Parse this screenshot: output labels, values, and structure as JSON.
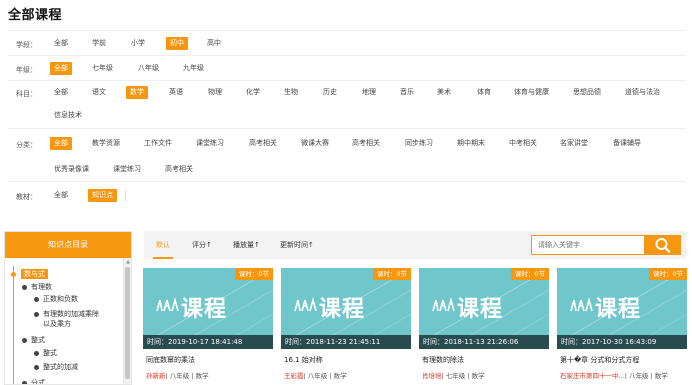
{
  "page_title": "全部课程",
  "filters": {
    "stage": {
      "label": "学段：",
      "options": [
        "全部",
        "学前",
        "小学",
        "初中",
        "高中"
      ],
      "active": "初中"
    },
    "grade": {
      "label": "年级：",
      "options": [
        "全部",
        "七年级",
        "八年级",
        "九年级"
      ],
      "active": "全部"
    },
    "subject": {
      "label": "科目：",
      "options": [
        "全部",
        "语文",
        "数学",
        "英语",
        "物理",
        "化学",
        "生物",
        "历史",
        "地理",
        "音乐",
        "美术",
        "体育",
        "体育与健康",
        "思想品德",
        "道德与法治",
        "信息技术"
      ],
      "active": "数学"
    },
    "category": {
      "label": "分类：",
      "options": [
        "全部",
        "教学资源",
        "工作文件",
        "课堂练习",
        "高考相关",
        "微课大赛",
        "高考相关",
        "同步练习",
        "期中期末",
        "中考相关",
        "名家讲堂",
        "备课辅导",
        "优秀录像课",
        "课堂练习",
        "高考相关"
      ],
      "active": "全部"
    },
    "textbook": {
      "label": "教材：",
      "options": [
        "全部",
        "知识点"
      ],
      "active": "知识点"
    }
  },
  "tree": {
    "title": "知识点目录",
    "nodes": [
      "数与式",
      "有理数",
      "正数和负数",
      "有理数的加减乘除",
      "以及乘方",
      "整式",
      "整式",
      "整式的加减",
      "分式"
    ]
  },
  "sortbar": {
    "options": [
      "默认",
      "评分↑",
      "播放量↑",
      "更新时间↑"
    ],
    "active": "默认",
    "search_placeholder": "请输入关键字"
  },
  "cards": [
    {
      "badge": "课时：0节",
      "logo": "课程",
      "time": "时间：2019-10-17 18:41:48",
      "title": "同底数幂的乘法",
      "teacher": "孙新新",
      "meta": "| 八年级 | 数学"
    },
    {
      "badge": "课时：0节",
      "logo": "课程",
      "time": "时间：2018-11-23 21:45:11",
      "title": "16.1 始对称",
      "teacher": "王彩霞",
      "meta": "| 八年级 | 数学"
    },
    {
      "badge": "课时：0节",
      "logo": "课程",
      "time": "时间：2018-11-13 21:26:06",
      "title": "有理数的除法",
      "teacher": "肖培培",
      "meta": "| 七年级 | 数学"
    },
    {
      "badge": "课时：0节",
      "logo": "课程",
      "time": "时间：2017-10-30 16:43:09",
      "title": "第十�章 分式和分式方程",
      "teacher": "石家庄市第四十一中...",
      "meta": "| 八年级 | 数学"
    }
  ],
  "colors": {
    "accent": "#f7960f",
    "thumb_bg": "#6fc7cb",
    "teacher": "#e0321e"
  },
  "icons": {
    "search": "search-icon",
    "logo": "course-logo-icon"
  }
}
